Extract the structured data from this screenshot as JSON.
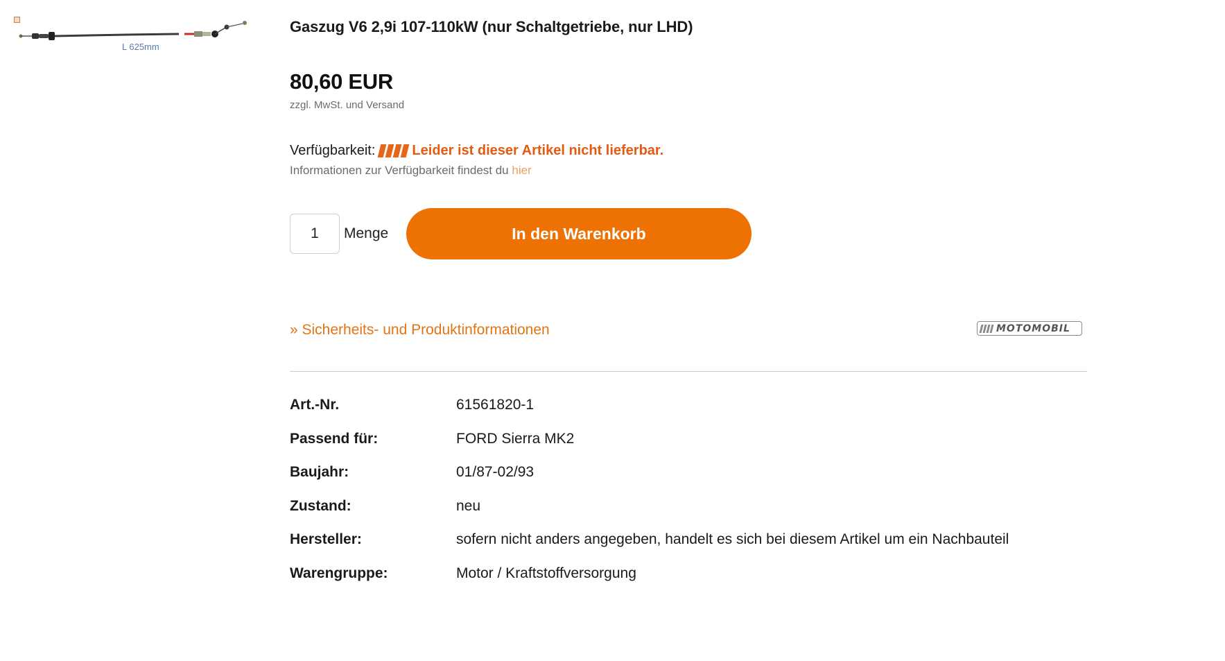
{
  "product": {
    "image_caption": "L 625mm",
    "title": "Gaszug V6 2,9i 107-110kW (nur Schaltgetriebe, nur LHD)",
    "price": "80,60 EUR",
    "price_note": "zzgl. MwSt. und Versand"
  },
  "availability": {
    "label": "Verfügbarkeit:",
    "status": "Leider ist dieser Artikel nicht lieferbar.",
    "info_text": "Informationen zur Verfügbarkeit findest du",
    "info_link": "hier",
    "status_color": "#e35a10"
  },
  "cart": {
    "quantity": "1",
    "quantity_label": "Menge",
    "button_label": "In den Warenkorb",
    "button_color": "#ee7203"
  },
  "safety_link": "» Sicherheits- und Produktinformationen",
  "brand_logo": "MOTOMOBIL",
  "specs": [
    {
      "label": "Art.-Nr.",
      "value": "61561820-1"
    },
    {
      "label": "Passend für:",
      "value": "FORD Sierra MK2"
    },
    {
      "label": "Baujahr:",
      "value": "01/87-02/93"
    },
    {
      "label": "Zustand:",
      "value": "neu"
    },
    {
      "label": "Hersteller:",
      "value": "sofern nicht anders angegeben, handelt es sich bei diesem Artikel um ein Nachbauteil"
    },
    {
      "label": "Warengruppe:",
      "value": "Motor / Kraftstoffversorgung"
    }
  ]
}
